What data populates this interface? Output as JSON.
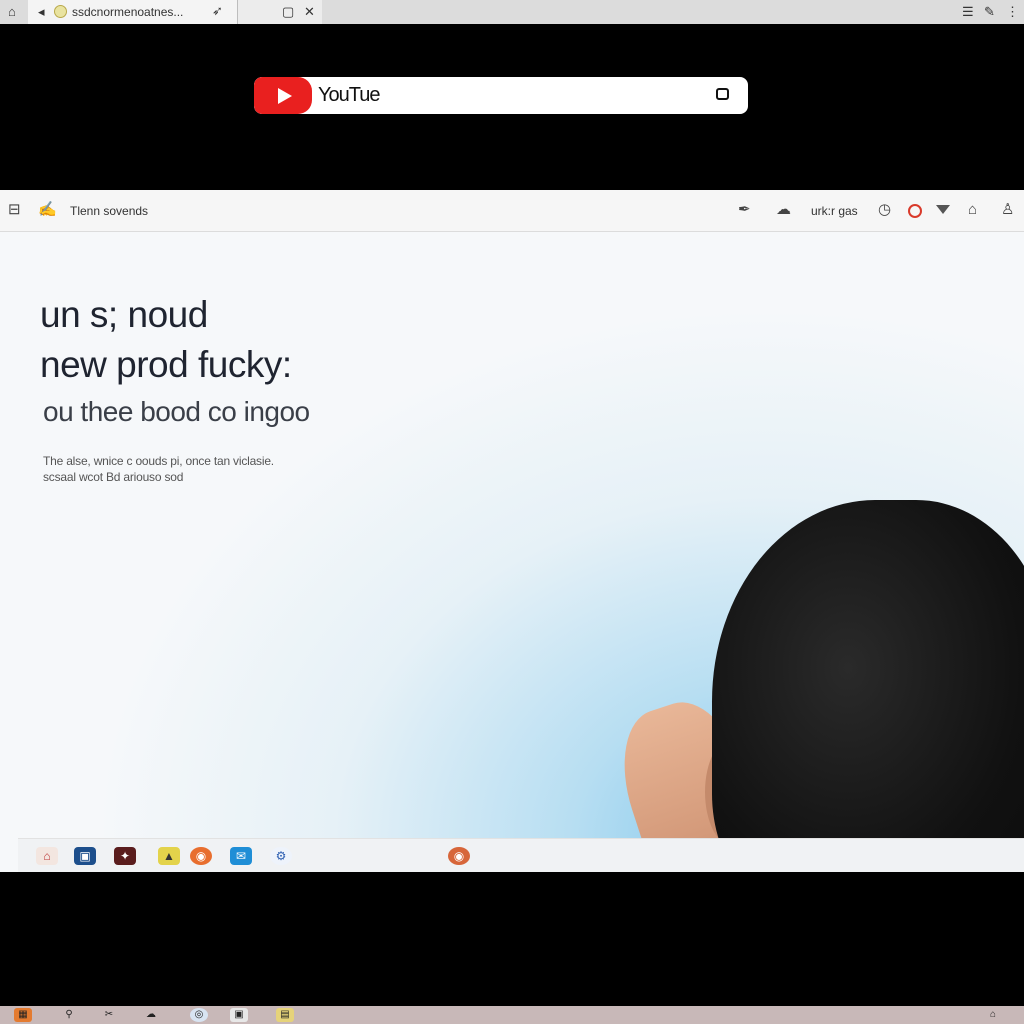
{
  "browser": {
    "tab_title": "ssdcnormenoatnes..."
  },
  "youtube": {
    "logo_text": "YouTue",
    "brand_color": "#e9201f"
  },
  "window": {
    "toolbar": {
      "left_label": "Tlenn sovends",
      "right_label": "urk:r gas"
    },
    "content": {
      "headline_1": "un s; noud",
      "headline_2": "new prod fucky:",
      "headline_3": "ou thee bood co ingoo",
      "small_1": "The alse, wnice c oouds pi, once tan viclasie.",
      "small_2": "scsaal wcot Bd ariouso sod"
    }
  },
  "icons": [
    "home-icon",
    "back-icon",
    "tab-favicon",
    "close-icon",
    "play-icon",
    "cast-icon",
    "window-icon",
    "bell-icon",
    "pen-icon",
    "cloud-icon",
    "clock-icon",
    "record-icon",
    "caret-down-icon",
    "lock-icon",
    "user-icon",
    "chrome-icon",
    "folder-icon"
  ]
}
